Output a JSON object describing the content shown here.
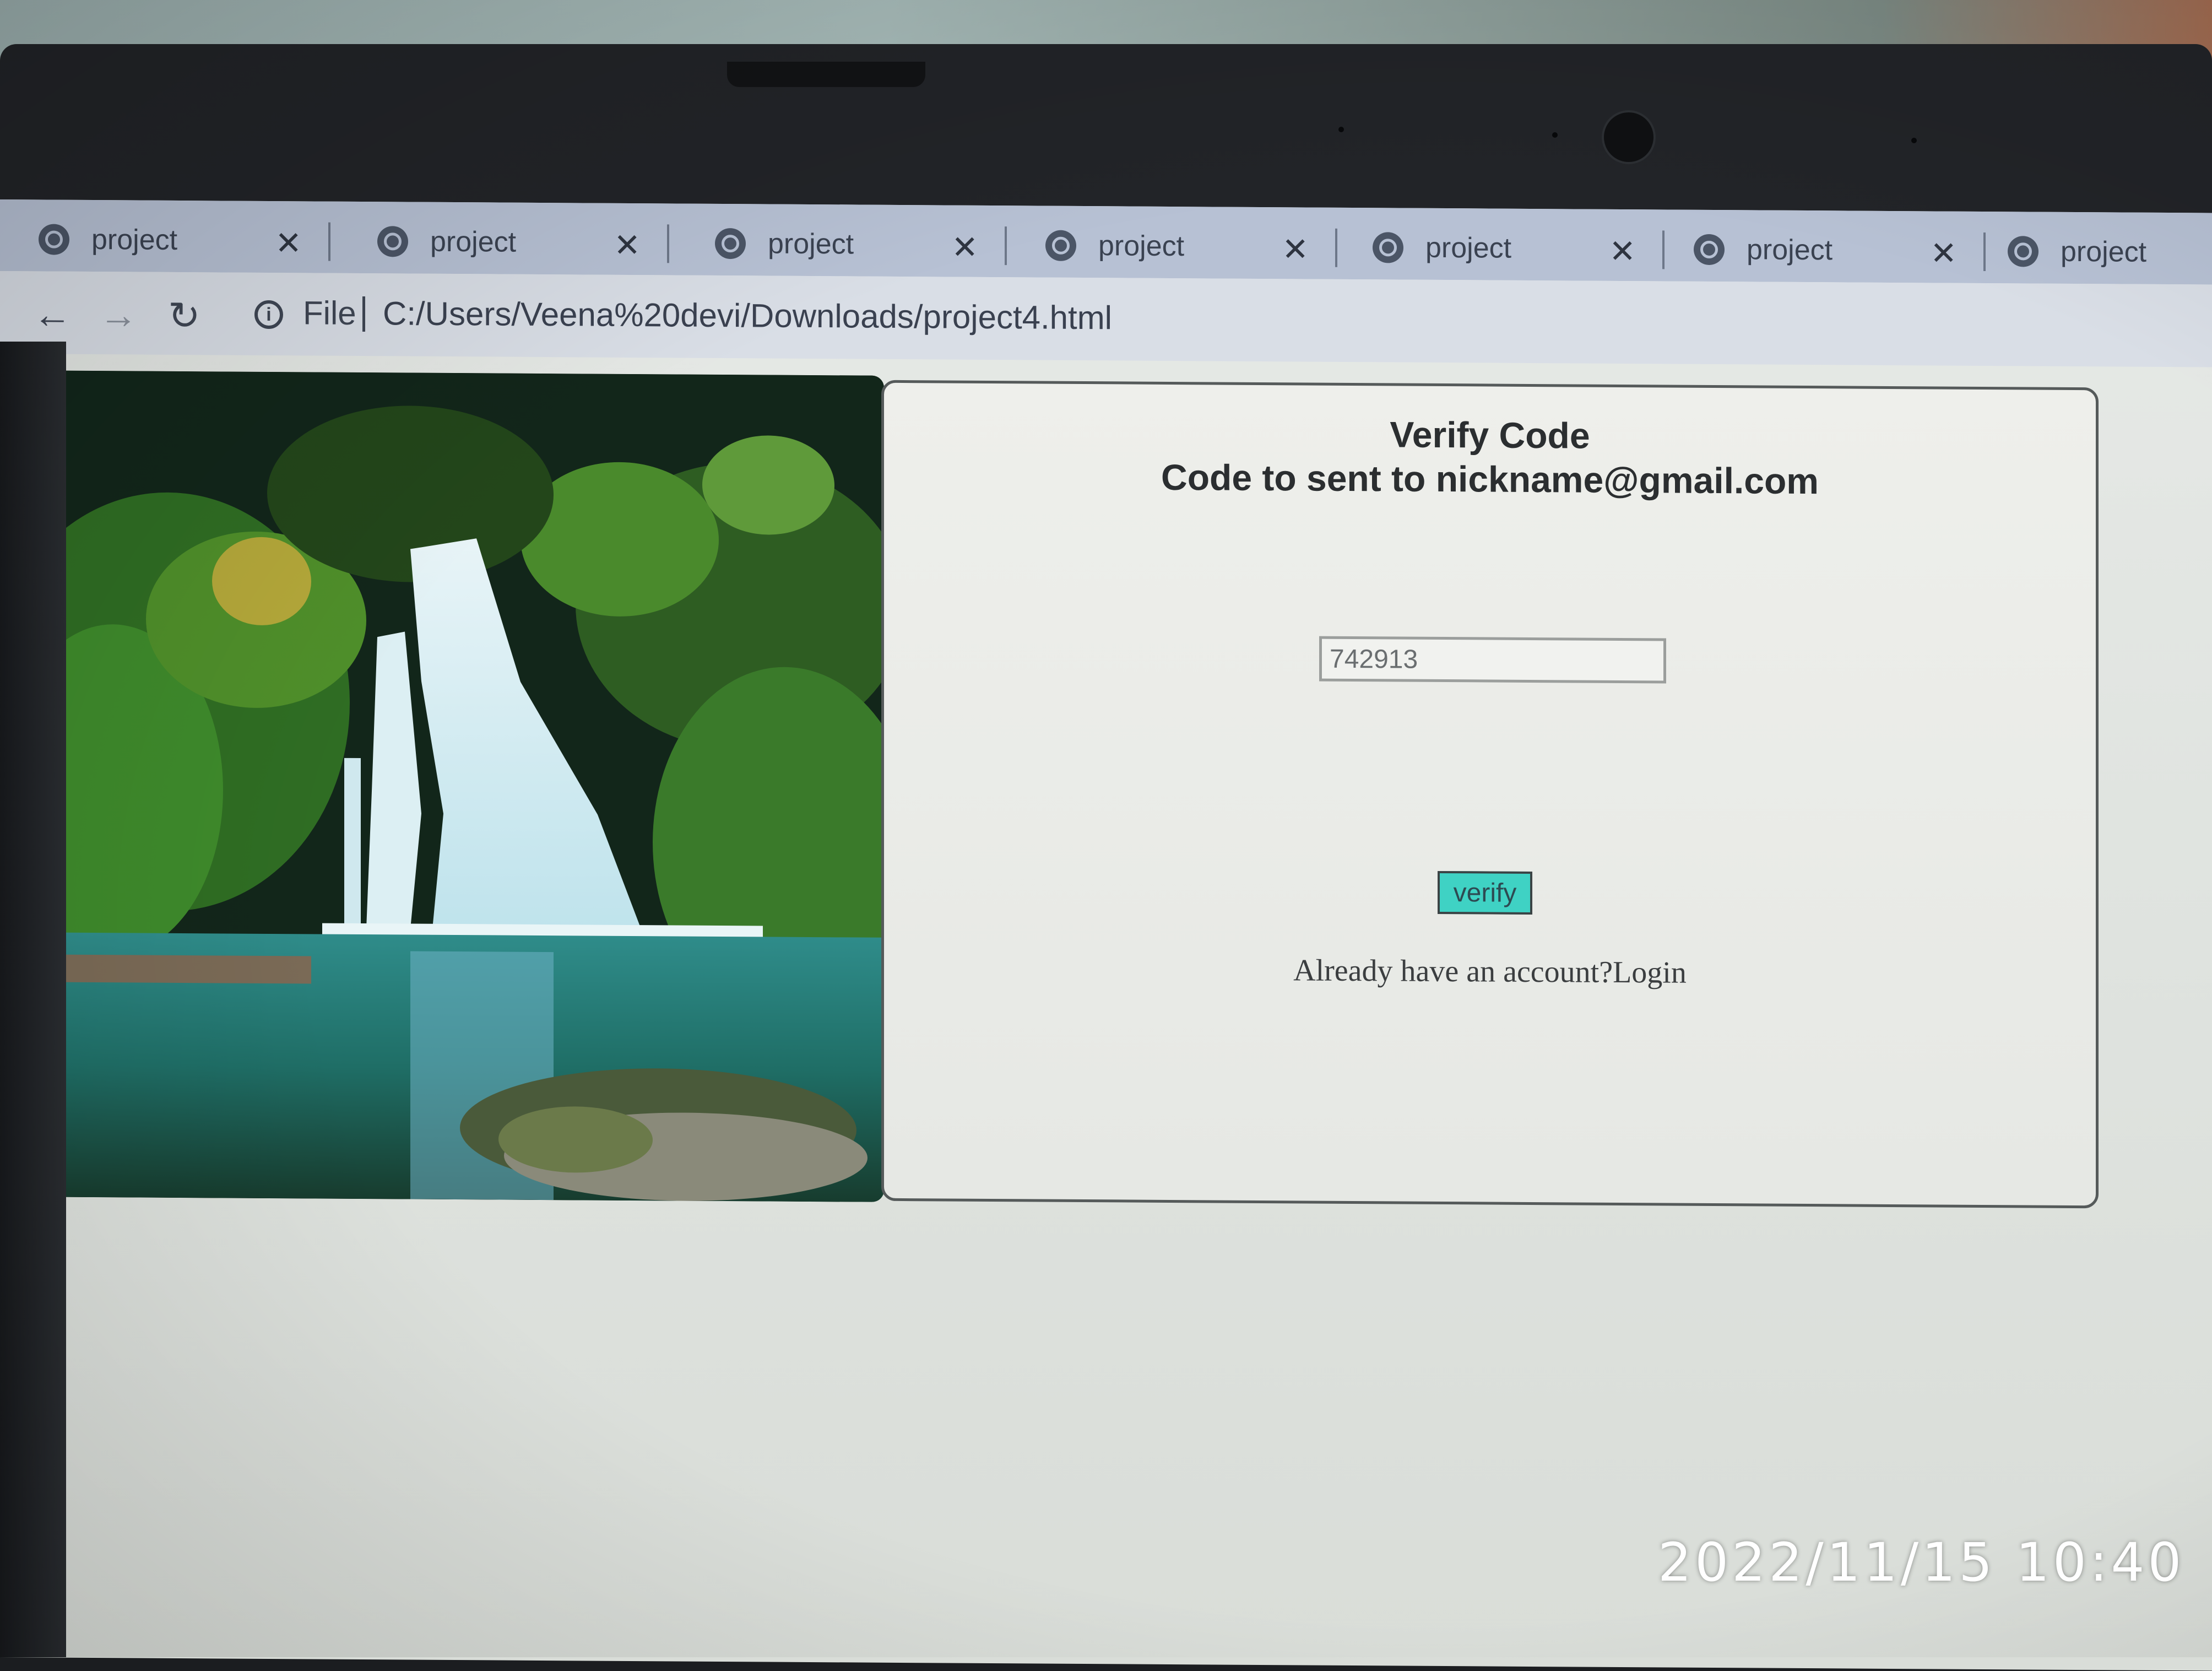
{
  "browser": {
    "tabs": [
      {
        "title": "project"
      },
      {
        "title": "project"
      },
      {
        "title": "project"
      },
      {
        "title": "project"
      },
      {
        "title": "project"
      },
      {
        "title": "project"
      },
      {
        "title": "project"
      }
    ],
    "close_glyph": "✕",
    "address": {
      "scheme_label": "File",
      "url": "C:/Users/Veena%20devi/Downloads/project4.html"
    },
    "icons": {
      "back": "back-arrow-icon",
      "forward": "forward-arrow-icon",
      "reload": "reload-icon",
      "info": "info-icon",
      "tab": "globe-icon"
    }
  },
  "page": {
    "title": "Verify Code",
    "subtitle": "Code to sent to nickname@gmail.com",
    "code_input": {
      "value": "742913"
    },
    "verify_button": "verify",
    "login_prompt": "Already have an account?Login",
    "colors": {
      "button": "#3fd2c4"
    }
  },
  "camera_overlay": {
    "timestamp": "2022/11/15  10:40"
  }
}
